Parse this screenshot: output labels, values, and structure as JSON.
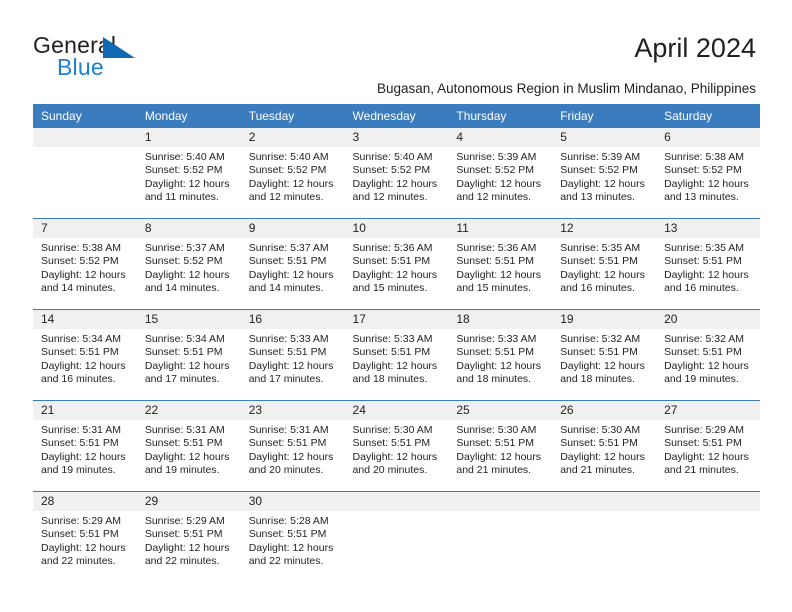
{
  "logo": {
    "word_one": "General",
    "word_two": "Blue",
    "triangle_color": "#1268b3",
    "blue_text_color": "#1f7fd0"
  },
  "header": {
    "month_title": "April 2024",
    "location": "Bugasan, Autonomous Region in Muslim Mindanao, Philippines"
  },
  "theme": {
    "header_bar_color": "#3b7cbf",
    "daynum_band_color": "#f0f0f0",
    "text_color": "#231f20"
  },
  "calendar": {
    "weekday_headers": [
      "Sunday",
      "Monday",
      "Tuesday",
      "Wednesday",
      "Thursday",
      "Friday",
      "Saturday"
    ],
    "weeks": [
      [
        {
          "day": "",
          "sunrise": "",
          "sunset": "",
          "daylight_a": "",
          "daylight_b": "",
          "empty": true
        },
        {
          "day": "1",
          "sunrise": "Sunrise: 5:40 AM",
          "sunset": "Sunset: 5:52 PM",
          "daylight_a": "Daylight: 12 hours",
          "daylight_b": "and 11 minutes."
        },
        {
          "day": "2",
          "sunrise": "Sunrise: 5:40 AM",
          "sunset": "Sunset: 5:52 PM",
          "daylight_a": "Daylight: 12 hours",
          "daylight_b": "and 12 minutes."
        },
        {
          "day": "3",
          "sunrise": "Sunrise: 5:40 AM",
          "sunset": "Sunset: 5:52 PM",
          "daylight_a": "Daylight: 12 hours",
          "daylight_b": "and 12 minutes."
        },
        {
          "day": "4",
          "sunrise": "Sunrise: 5:39 AM",
          "sunset": "Sunset: 5:52 PM",
          "daylight_a": "Daylight: 12 hours",
          "daylight_b": "and 12 minutes."
        },
        {
          "day": "5",
          "sunrise": "Sunrise: 5:39 AM",
          "sunset": "Sunset: 5:52 PM",
          "daylight_a": "Daylight: 12 hours",
          "daylight_b": "and 13 minutes."
        },
        {
          "day": "6",
          "sunrise": "Sunrise: 5:38 AM",
          "sunset": "Sunset: 5:52 PM",
          "daylight_a": "Daylight: 12 hours",
          "daylight_b": "and 13 minutes."
        }
      ],
      [
        {
          "day": "7",
          "sunrise": "Sunrise: 5:38 AM",
          "sunset": "Sunset: 5:52 PM",
          "daylight_a": "Daylight: 12 hours",
          "daylight_b": "and 14 minutes."
        },
        {
          "day": "8",
          "sunrise": "Sunrise: 5:37 AM",
          "sunset": "Sunset: 5:52 PM",
          "daylight_a": "Daylight: 12 hours",
          "daylight_b": "and 14 minutes."
        },
        {
          "day": "9",
          "sunrise": "Sunrise: 5:37 AM",
          "sunset": "Sunset: 5:51 PM",
          "daylight_a": "Daylight: 12 hours",
          "daylight_b": "and 14 minutes."
        },
        {
          "day": "10",
          "sunrise": "Sunrise: 5:36 AM",
          "sunset": "Sunset: 5:51 PM",
          "daylight_a": "Daylight: 12 hours",
          "daylight_b": "and 15 minutes."
        },
        {
          "day": "11",
          "sunrise": "Sunrise: 5:36 AM",
          "sunset": "Sunset: 5:51 PM",
          "daylight_a": "Daylight: 12 hours",
          "daylight_b": "and 15 minutes."
        },
        {
          "day": "12",
          "sunrise": "Sunrise: 5:35 AM",
          "sunset": "Sunset: 5:51 PM",
          "daylight_a": "Daylight: 12 hours",
          "daylight_b": "and 16 minutes."
        },
        {
          "day": "13",
          "sunrise": "Sunrise: 5:35 AM",
          "sunset": "Sunset: 5:51 PM",
          "daylight_a": "Daylight: 12 hours",
          "daylight_b": "and 16 minutes."
        }
      ],
      [
        {
          "day": "14",
          "sunrise": "Sunrise: 5:34 AM",
          "sunset": "Sunset: 5:51 PM",
          "daylight_a": "Daylight: 12 hours",
          "daylight_b": "and 16 minutes."
        },
        {
          "day": "15",
          "sunrise": "Sunrise: 5:34 AM",
          "sunset": "Sunset: 5:51 PM",
          "daylight_a": "Daylight: 12 hours",
          "daylight_b": "and 17 minutes."
        },
        {
          "day": "16",
          "sunrise": "Sunrise: 5:33 AM",
          "sunset": "Sunset: 5:51 PM",
          "daylight_a": "Daylight: 12 hours",
          "daylight_b": "and 17 minutes."
        },
        {
          "day": "17",
          "sunrise": "Sunrise: 5:33 AM",
          "sunset": "Sunset: 5:51 PM",
          "daylight_a": "Daylight: 12 hours",
          "daylight_b": "and 18 minutes."
        },
        {
          "day": "18",
          "sunrise": "Sunrise: 5:33 AM",
          "sunset": "Sunset: 5:51 PM",
          "daylight_a": "Daylight: 12 hours",
          "daylight_b": "and 18 minutes."
        },
        {
          "day": "19",
          "sunrise": "Sunrise: 5:32 AM",
          "sunset": "Sunset: 5:51 PM",
          "daylight_a": "Daylight: 12 hours",
          "daylight_b": "and 18 minutes."
        },
        {
          "day": "20",
          "sunrise": "Sunrise: 5:32 AM",
          "sunset": "Sunset: 5:51 PM",
          "daylight_a": "Daylight: 12 hours",
          "daylight_b": "and 19 minutes."
        }
      ],
      [
        {
          "day": "21",
          "sunrise": "Sunrise: 5:31 AM",
          "sunset": "Sunset: 5:51 PM",
          "daylight_a": "Daylight: 12 hours",
          "daylight_b": "and 19 minutes."
        },
        {
          "day": "22",
          "sunrise": "Sunrise: 5:31 AM",
          "sunset": "Sunset: 5:51 PM",
          "daylight_a": "Daylight: 12 hours",
          "daylight_b": "and 19 minutes."
        },
        {
          "day": "23",
          "sunrise": "Sunrise: 5:31 AM",
          "sunset": "Sunset: 5:51 PM",
          "daylight_a": "Daylight: 12 hours",
          "daylight_b": "and 20 minutes."
        },
        {
          "day": "24",
          "sunrise": "Sunrise: 5:30 AM",
          "sunset": "Sunset: 5:51 PM",
          "daylight_a": "Daylight: 12 hours",
          "daylight_b": "and 20 minutes."
        },
        {
          "day": "25",
          "sunrise": "Sunrise: 5:30 AM",
          "sunset": "Sunset: 5:51 PM",
          "daylight_a": "Daylight: 12 hours",
          "daylight_b": "and 21 minutes."
        },
        {
          "day": "26",
          "sunrise": "Sunrise: 5:30 AM",
          "sunset": "Sunset: 5:51 PM",
          "daylight_a": "Daylight: 12 hours",
          "daylight_b": "and 21 minutes."
        },
        {
          "day": "27",
          "sunrise": "Sunrise: 5:29 AM",
          "sunset": "Sunset: 5:51 PM",
          "daylight_a": "Daylight: 12 hours",
          "daylight_b": "and 21 minutes."
        }
      ],
      [
        {
          "day": "28",
          "sunrise": "Sunrise: 5:29 AM",
          "sunset": "Sunset: 5:51 PM",
          "daylight_a": "Daylight: 12 hours",
          "daylight_b": "and 22 minutes."
        },
        {
          "day": "29",
          "sunrise": "Sunrise: 5:29 AM",
          "sunset": "Sunset: 5:51 PM",
          "daylight_a": "Daylight: 12 hours",
          "daylight_b": "and 22 minutes."
        },
        {
          "day": "30",
          "sunrise": "Sunrise: 5:28 AM",
          "sunset": "Sunset: 5:51 PM",
          "daylight_a": "Daylight: 12 hours",
          "daylight_b": "and 22 minutes."
        },
        {
          "day": "",
          "sunrise": "",
          "sunset": "",
          "daylight_a": "",
          "daylight_b": "",
          "empty": true
        },
        {
          "day": "",
          "sunrise": "",
          "sunset": "",
          "daylight_a": "",
          "daylight_b": "",
          "empty": true
        },
        {
          "day": "",
          "sunrise": "",
          "sunset": "",
          "daylight_a": "",
          "daylight_b": "",
          "empty": true
        },
        {
          "day": "",
          "sunrise": "",
          "sunset": "",
          "daylight_a": "",
          "daylight_b": "",
          "empty": true
        }
      ]
    ]
  }
}
